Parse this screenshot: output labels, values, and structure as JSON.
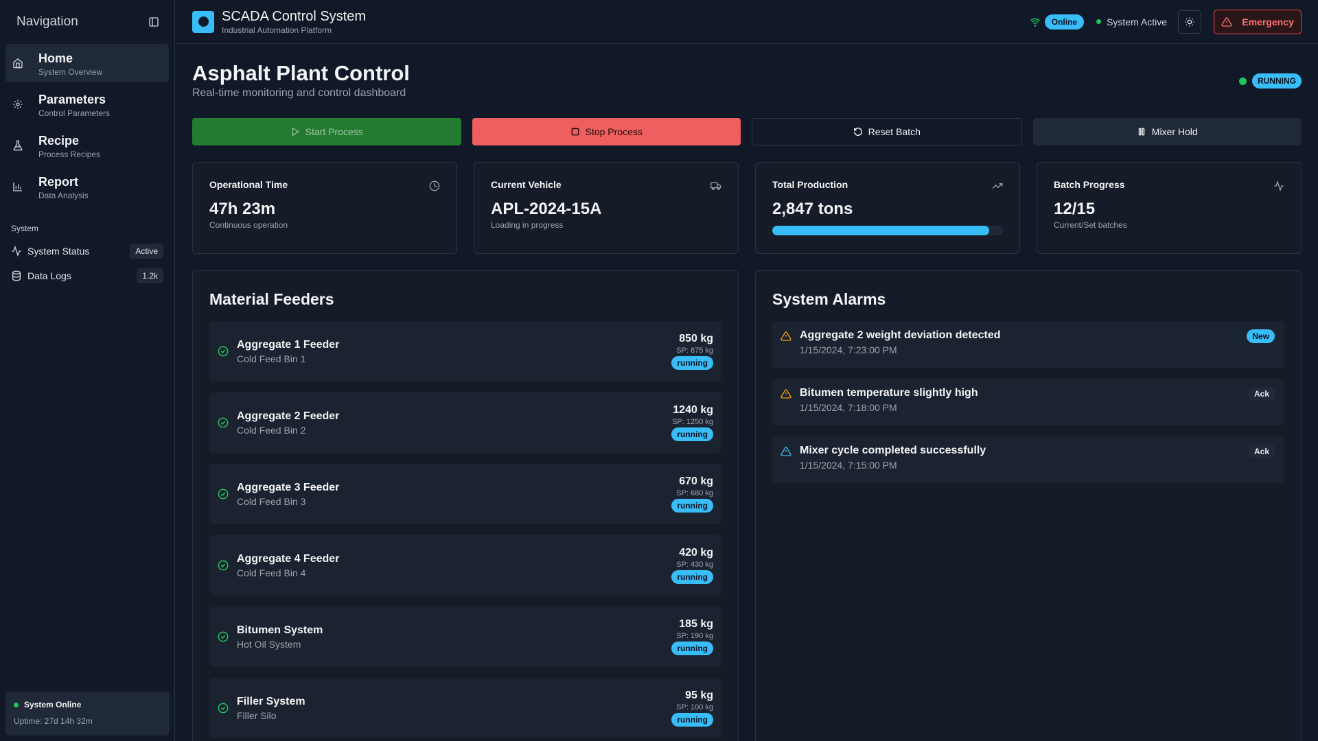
{
  "sidebar": {
    "title": "Navigation",
    "nav": [
      {
        "label": "Home",
        "sub": "System Overview",
        "icon": "home-icon"
      },
      {
        "label": "Parameters",
        "sub": "Control Parameters",
        "icon": "gear-icon"
      },
      {
        "label": "Recipe",
        "sub": "Process Recipes",
        "icon": "flask-icon"
      },
      {
        "label": "Report",
        "sub": "Data Analysis",
        "icon": "bar-chart-icon"
      }
    ],
    "section": "System",
    "system_items": [
      {
        "label": "System Status",
        "badge": "Active",
        "icon": "activity-icon"
      },
      {
        "label": "Data Logs",
        "badge": "1.2k",
        "icon": "database-icon"
      }
    ],
    "footer": {
      "status": "System Online",
      "uptime": "Uptime: 27d 14h 32m"
    }
  },
  "header": {
    "title": "SCADA Control System",
    "subtitle": "Industrial Automation Platform",
    "online": "Online",
    "system_active": "System Active",
    "emergency": "Emergency"
  },
  "page": {
    "title": "Asphalt Plant Control",
    "subtitle": "Real-time monitoring and control dashboard",
    "status": "RUNNING"
  },
  "actions": {
    "start": "Start Process",
    "stop": "Stop Process",
    "reset": "Reset Batch",
    "hold": "Mixer Hold"
  },
  "stats": {
    "op_time": {
      "label": "Operational Time",
      "value": "47h 23m",
      "note": "Continuous operation"
    },
    "vehicle": {
      "label": "Current Vehicle",
      "value": "APL-2024-15A",
      "note": "Loading in progress"
    },
    "production": {
      "label": "Total Production",
      "value": "2,847 tons",
      "progress": 0.94
    },
    "batch": {
      "label": "Batch Progress",
      "value": "12/15",
      "note": "Current/Set batches"
    }
  },
  "feeders": {
    "title": "Material Feeders",
    "items": [
      {
        "name": "Aggregate 1 Feeder",
        "bin": "Cold Feed Bin 1",
        "value": "850 kg",
        "sp": "SP: 875 kg",
        "status": "running"
      },
      {
        "name": "Aggregate 2 Feeder",
        "bin": "Cold Feed Bin 2",
        "value": "1240 kg",
        "sp": "SP: 1250 kg",
        "status": "running"
      },
      {
        "name": "Aggregate 3 Feeder",
        "bin": "Cold Feed Bin 3",
        "value": "670 kg",
        "sp": "SP: 680 kg",
        "status": "running"
      },
      {
        "name": "Aggregate 4 Feeder",
        "bin": "Cold Feed Bin 4",
        "value": "420 kg",
        "sp": "SP: 430 kg",
        "status": "running"
      },
      {
        "name": "Bitumen System",
        "bin": "Hot Oil System",
        "value": "185 kg",
        "sp": "SP: 190 kg",
        "status": "running"
      },
      {
        "name": "Filler System",
        "bin": "Filler Silo",
        "value": "95 kg",
        "sp": "SP: 100 kg",
        "status": "running"
      }
    ]
  },
  "alarms": {
    "title": "System Alarms",
    "items": [
      {
        "message": "Aggregate 2 weight deviation detected",
        "time": "1/15/2024, 7:23:00 PM",
        "badge": "New",
        "level": "warning",
        "color": "#f59e0b"
      },
      {
        "message": "Bitumen temperature slightly high",
        "time": "1/15/2024, 7:18:00 PM",
        "badge": "Ack",
        "level": "warning",
        "color": "#f59e0b"
      },
      {
        "message": "Mixer cycle completed successfully",
        "time": "1/15/2024, 7:15:00 PM",
        "badge": "Ack",
        "level": "info",
        "color": "#38bdf8"
      }
    ]
  },
  "colors": {
    "accent": "#38bdf8",
    "ok": "#22c55e",
    "danger": "#ef4444",
    "start": "#237b2f",
    "stop": "#ef5f5f"
  }
}
